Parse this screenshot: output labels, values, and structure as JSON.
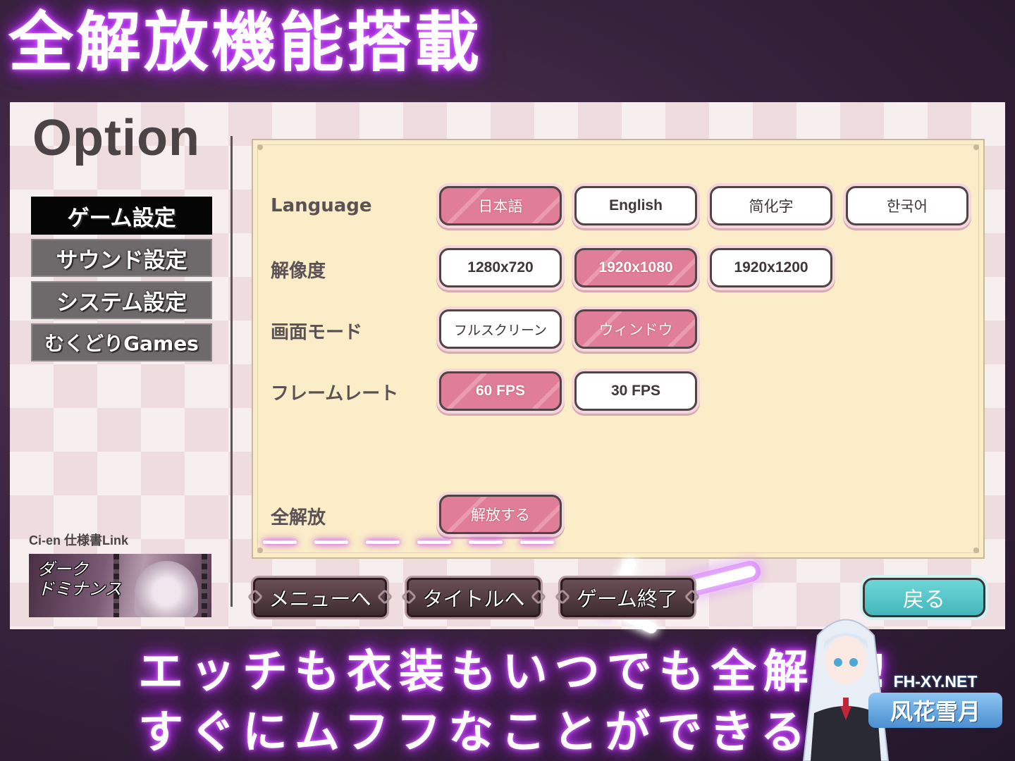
{
  "top_banner": {
    "title": "全解放機能搭載"
  },
  "option_panel": {
    "title": "Option",
    "sidebar": [
      {
        "label": "ゲーム設定",
        "active": true
      },
      {
        "label": "サウンド設定",
        "active": false
      },
      {
        "label": "システム設定",
        "active": false
      },
      {
        "label": "むくどりGames",
        "active": false
      }
    ],
    "cien_link": {
      "label": "Ci-en 仕様書Link",
      "banner_text": "ダーク\nドミナンス"
    },
    "settings": {
      "language": {
        "label": "Language",
        "options": [
          "日本語",
          "English",
          "简化字",
          "한국어"
        ],
        "selected": "日本語"
      },
      "resolution": {
        "label": "解像度",
        "options": [
          "1280x720",
          "1920x1080",
          "1920x1200"
        ],
        "selected": "1920x1080"
      },
      "screen_mode": {
        "label": "画面モード",
        "options": [
          "フルスクリーン",
          "ウィンドウ"
        ],
        "selected": "ウィンドウ"
      },
      "frame_rate": {
        "label": "フレームレート",
        "options": [
          "60 FPS",
          "30 FPS"
        ],
        "selected": "60 FPS"
      },
      "unlock_all": {
        "label": "全解放",
        "button": "解放する"
      }
    },
    "bottom_buttons": {
      "menu": "メニューへ",
      "title": "タイトルへ",
      "quit": "ゲーム終了",
      "back": "戻る"
    }
  },
  "bottom_banner": {
    "line1": "エッチも衣装もいつでも全解放!",
    "line2": "すぐにムフフなことができる!"
  },
  "watermark": {
    "url": "FH-XY.NET",
    "name": "风花雪月"
  },
  "colors": {
    "selected_pink": "#e07d98",
    "glow_purple": "#c040ff",
    "back_teal": "#44b7bc",
    "panel_cream": "#fbedc8"
  }
}
